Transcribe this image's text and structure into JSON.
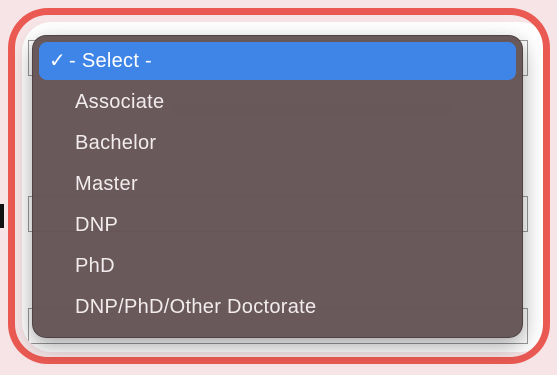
{
  "dropdown": {
    "selected_label": "- Select -",
    "check_icon": "checkmark-icon",
    "options": [
      "Associate",
      "Bachelor",
      "Master",
      "DNP",
      "PhD",
      "DNP/PhD/Other Doctorate"
    ]
  },
  "colors": {
    "highlight_frame": "#ea5a53",
    "selected_bg": "#3f85e8",
    "menu_bg": "#645456",
    "page_bg": "#f6e4e6"
  }
}
